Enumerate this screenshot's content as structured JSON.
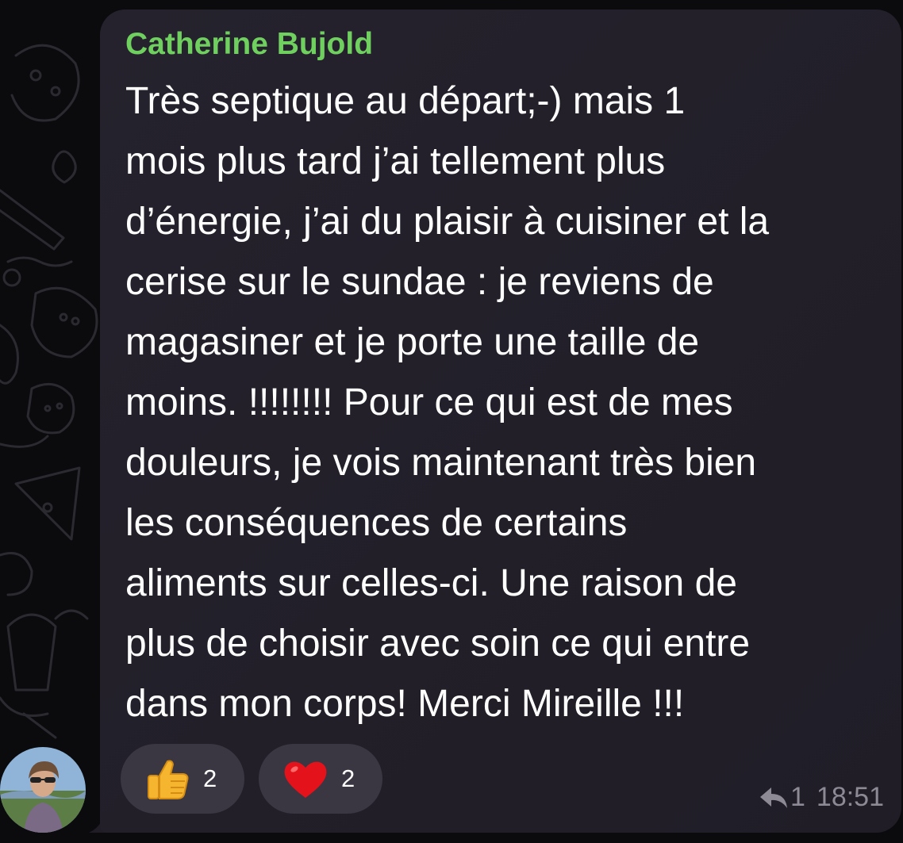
{
  "message": {
    "sender": "Catherine Bujold",
    "sender_color": "#6fcf5f",
    "lines": [
      "Très septique au départ;-) mais 1",
      "mois plus tard j’ai tellement plus",
      "d’énergie, j’ai du plaisir à cuisiner et la",
      "cerise sur le sundae : je reviens de",
      "magasiner et je porte une taille de",
      "moins. !!!!!!!! Pour ce qui est de mes",
      "douleurs, je vois maintenant très bien",
      "les conséquences de certains",
      "aliments sur celles-ci. Une raison de",
      "plus de choisir avec soin ce qui entre",
      "dans mon corps! Merci Mireille !!!"
    ],
    "reactions": [
      {
        "emoji": "thumbs-up-icon",
        "count": "2"
      },
      {
        "emoji": "red-heart-icon",
        "count": "2"
      }
    ],
    "reply_icon": "reply-arrow-icon",
    "reply_count": "1",
    "time": "18:51"
  },
  "avatar": "avatar"
}
